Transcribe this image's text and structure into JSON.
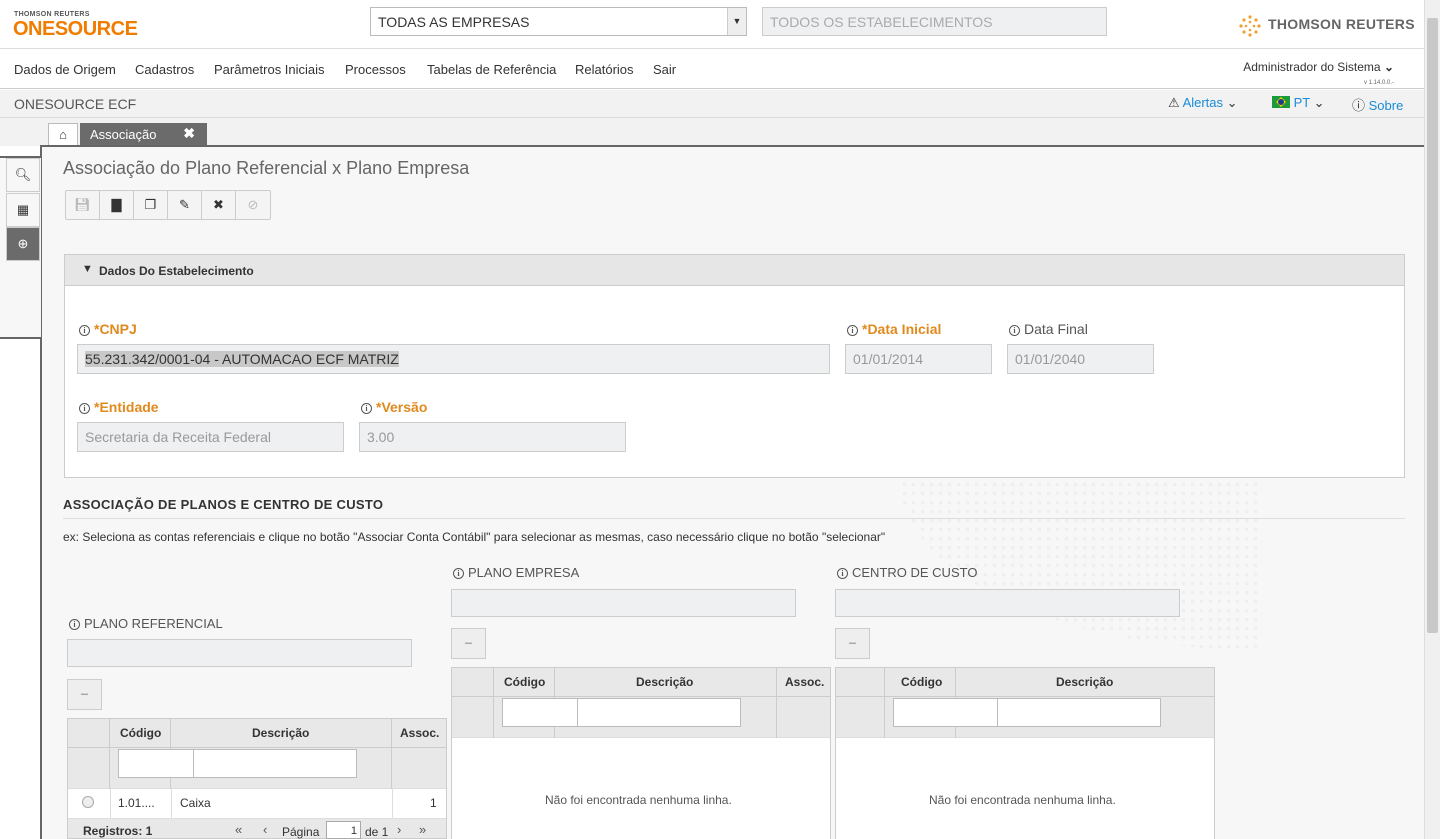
{
  "header": {
    "brand_top": "THOMSON REUTERS",
    "brand_main": "ONESOURCE",
    "company_select": "TODAS AS EMPRESAS",
    "estab_placeholder": "TODOS OS ESTABELECIMENTOS",
    "tr_brand": "THOMSON REUTERS"
  },
  "menu": {
    "items": [
      "Dados de Origem",
      "Cadastros",
      "Parâmetros Iniciais",
      "Processos",
      "Tabelas de Referência",
      "Relatórios",
      "Sair"
    ],
    "user": "Administrador do Sistema",
    "version": "v 1.14.0.0.-"
  },
  "appbar": {
    "app_name": "ONESOURCE ECF",
    "alerts": "Alertas",
    "language": "PT",
    "about": "Sobre"
  },
  "tabs": {
    "active": "Associação"
  },
  "page": {
    "title": "Associação do Plano Referencial x Plano Empresa"
  },
  "panel": {
    "title": "Dados Do Estabelecimento",
    "cnpj_label": "*CNPJ",
    "cnpj_value": "55.231.342/0001-04 - AUTOMACAO ECF MATRIZ",
    "data_inicial_label": "*Data Inicial",
    "data_inicial_value": "01/01/2014",
    "data_final_label": "Data Final",
    "data_final_value": "01/01/2040",
    "entidade_label": "*Entidade",
    "entidade_value": "Secretaria da Receita Federal",
    "versao_label": "*Versão",
    "versao_value": "3.00"
  },
  "section": {
    "title": "ASSOCIAÇÃO DE PLANOS E CENTRO DE CUSTO",
    "hint": "ex: Seleciona as contas referenciais e clique no botão \"Associar Conta Contábil\" para selecionar as mesmas, caso necessário clique no botão \"selecionar\""
  },
  "plano_referencial": {
    "label": "PLANO REFERENCIAL",
    "col_codigo": "Código",
    "col_descricao": "Descrição",
    "col_assoc": "Assoc.",
    "rows": [
      {
        "codigo": "1.01....",
        "descricao": "Caixa",
        "assoc": "1"
      }
    ],
    "registros": "Registros: 1",
    "pagina": "Página",
    "page_value": "1",
    "de": "de 1"
  },
  "plano_empresa": {
    "label": "PLANO EMPRESA",
    "col_codigo": "Código",
    "col_descricao": "Descrição",
    "col_assoc": "Assoc.",
    "empty": "Não foi encontrada nenhuma linha."
  },
  "centro_custo": {
    "label": "CENTRO DE CUSTO",
    "col_codigo": "Código",
    "col_descricao": "Descrição",
    "empty": "Não foi encontrada nenhuma linha."
  },
  "colors": {
    "brand_orange": "#f07c00",
    "required_label": "#e08a1e",
    "link_blue": "#1a8cd8"
  }
}
